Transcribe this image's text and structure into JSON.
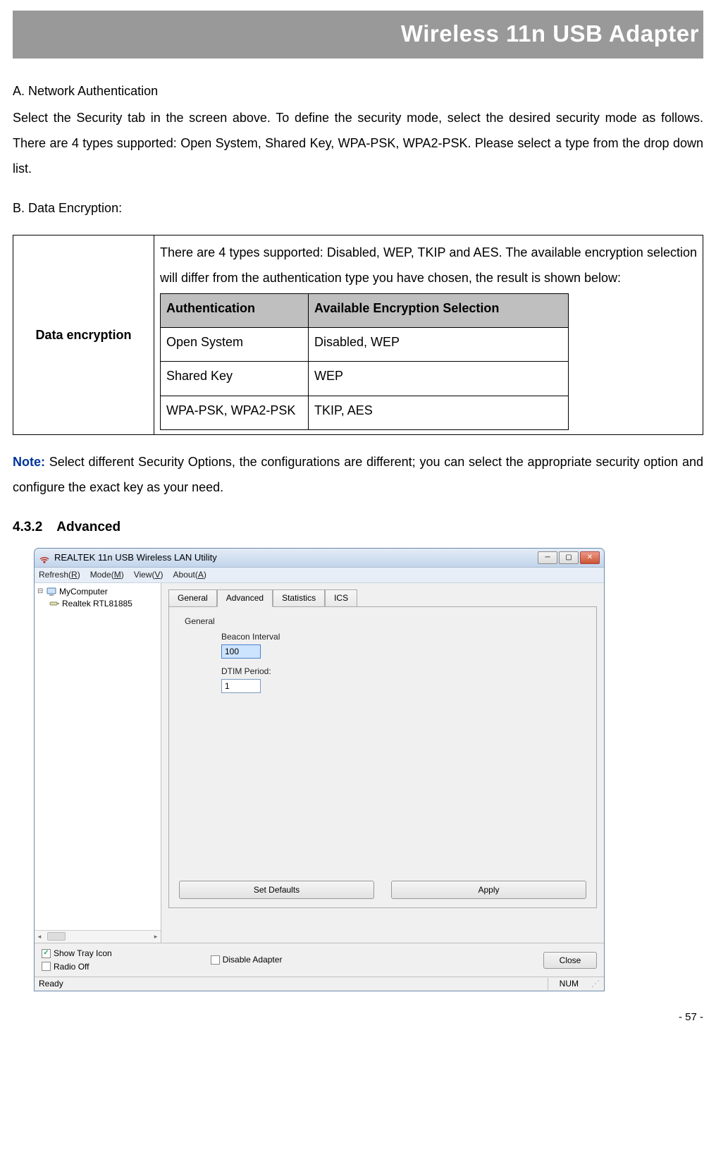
{
  "header_title": "Wireless 11n USB Adapter",
  "section_a": {
    "heading": "A. Network Authentication",
    "body": "Select the Security tab in the screen above. To define the security mode, select the desired security mode as follows. There are 4 types supported: Open System, Shared Key, WPA-PSK, WPA2-PSK. Please select a type from the drop down list."
  },
  "section_b": {
    "heading": "B. Data Encryption:",
    "left_cell": "Data encryption",
    "intro": "There are 4 types supported: Disabled, WEP, TKIP and AES. The available encryption selection will differ from the authentication type you have chosen, the result is shown below:",
    "inner_table": {
      "headers": [
        "Authentication",
        "Available Encryption Selection"
      ],
      "rows": [
        [
          "Open System",
          "Disabled, WEP"
        ],
        [
          "Shared Key",
          "WEP"
        ],
        [
          "WPA-PSK, WPA2-PSK",
          "TKIP, AES"
        ]
      ]
    }
  },
  "note": {
    "label": "Note:",
    "body": " Select different Security Options, the configurations are different; you can select the appropriate security option and configure the exact key as your need."
  },
  "heading_432": {
    "num": "4.3.2",
    "title": "Advanced"
  },
  "window": {
    "title": "REALTEK 11n USB Wireless LAN Utility",
    "menu": [
      "Refresh(R)",
      "Mode(M)",
      "View(V)",
      "About(A)"
    ],
    "tree": {
      "root": "MyComputer",
      "child": "Realtek RTL81885"
    },
    "tabs": [
      "General",
      "Advanced",
      "Statistics",
      "ICS"
    ],
    "active_tab": "Advanced",
    "panel": {
      "group": "General",
      "beacon_label": "Beacon Interval",
      "beacon_val": "100",
      "dtim_label": "DTIM Period:",
      "dtim_val": "1"
    },
    "buttons": {
      "set_defaults": "Set Defaults",
      "apply": "Apply"
    },
    "bottom": {
      "show_tray": "Show Tray Icon",
      "radio_off": "Radio Off",
      "disable_adapter": "Disable Adapter",
      "close": "Close"
    },
    "status": {
      "ready": "Ready",
      "num": "NUM"
    }
  },
  "page_number": "- 57 -"
}
